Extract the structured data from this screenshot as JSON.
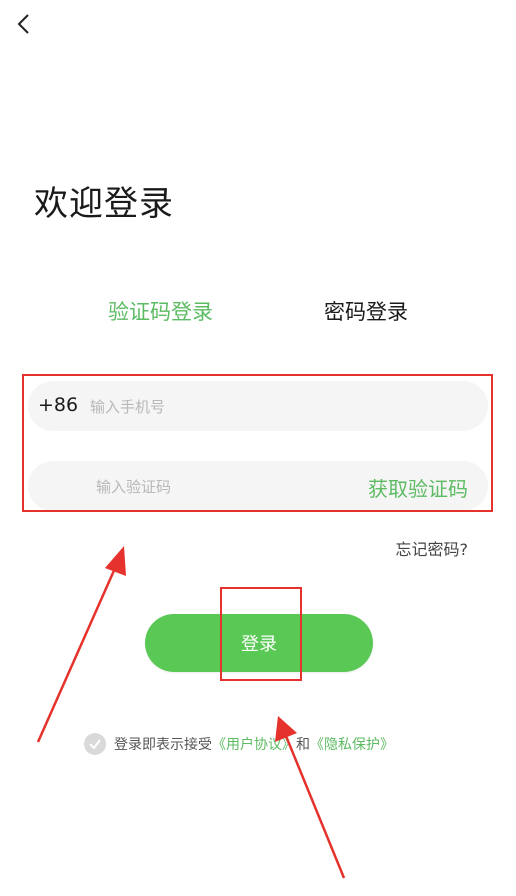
{
  "header": {
    "back_icon": "chevron-left-icon"
  },
  "title": "欢迎登录",
  "tabs": [
    {
      "label": "验证码登录",
      "active": true
    },
    {
      "label": "密码登录",
      "active": false
    }
  ],
  "phone": {
    "country_code": "+86",
    "placeholder": "输入手机号",
    "value": ""
  },
  "code": {
    "placeholder": "输入验证码",
    "value": "",
    "get_code_label": "获取验证码"
  },
  "forgot_password": "忘记密码?",
  "login_button": "登录",
  "agreement": {
    "checked": false,
    "prefix": "登录即表示接受",
    "user_agreement": "《用户协议》",
    "conjunction": "和",
    "privacy_policy": "《隐私保护》"
  },
  "colors": {
    "accent": "#5dbb63",
    "button": "#5ac854",
    "annotation": "#e5322d"
  }
}
